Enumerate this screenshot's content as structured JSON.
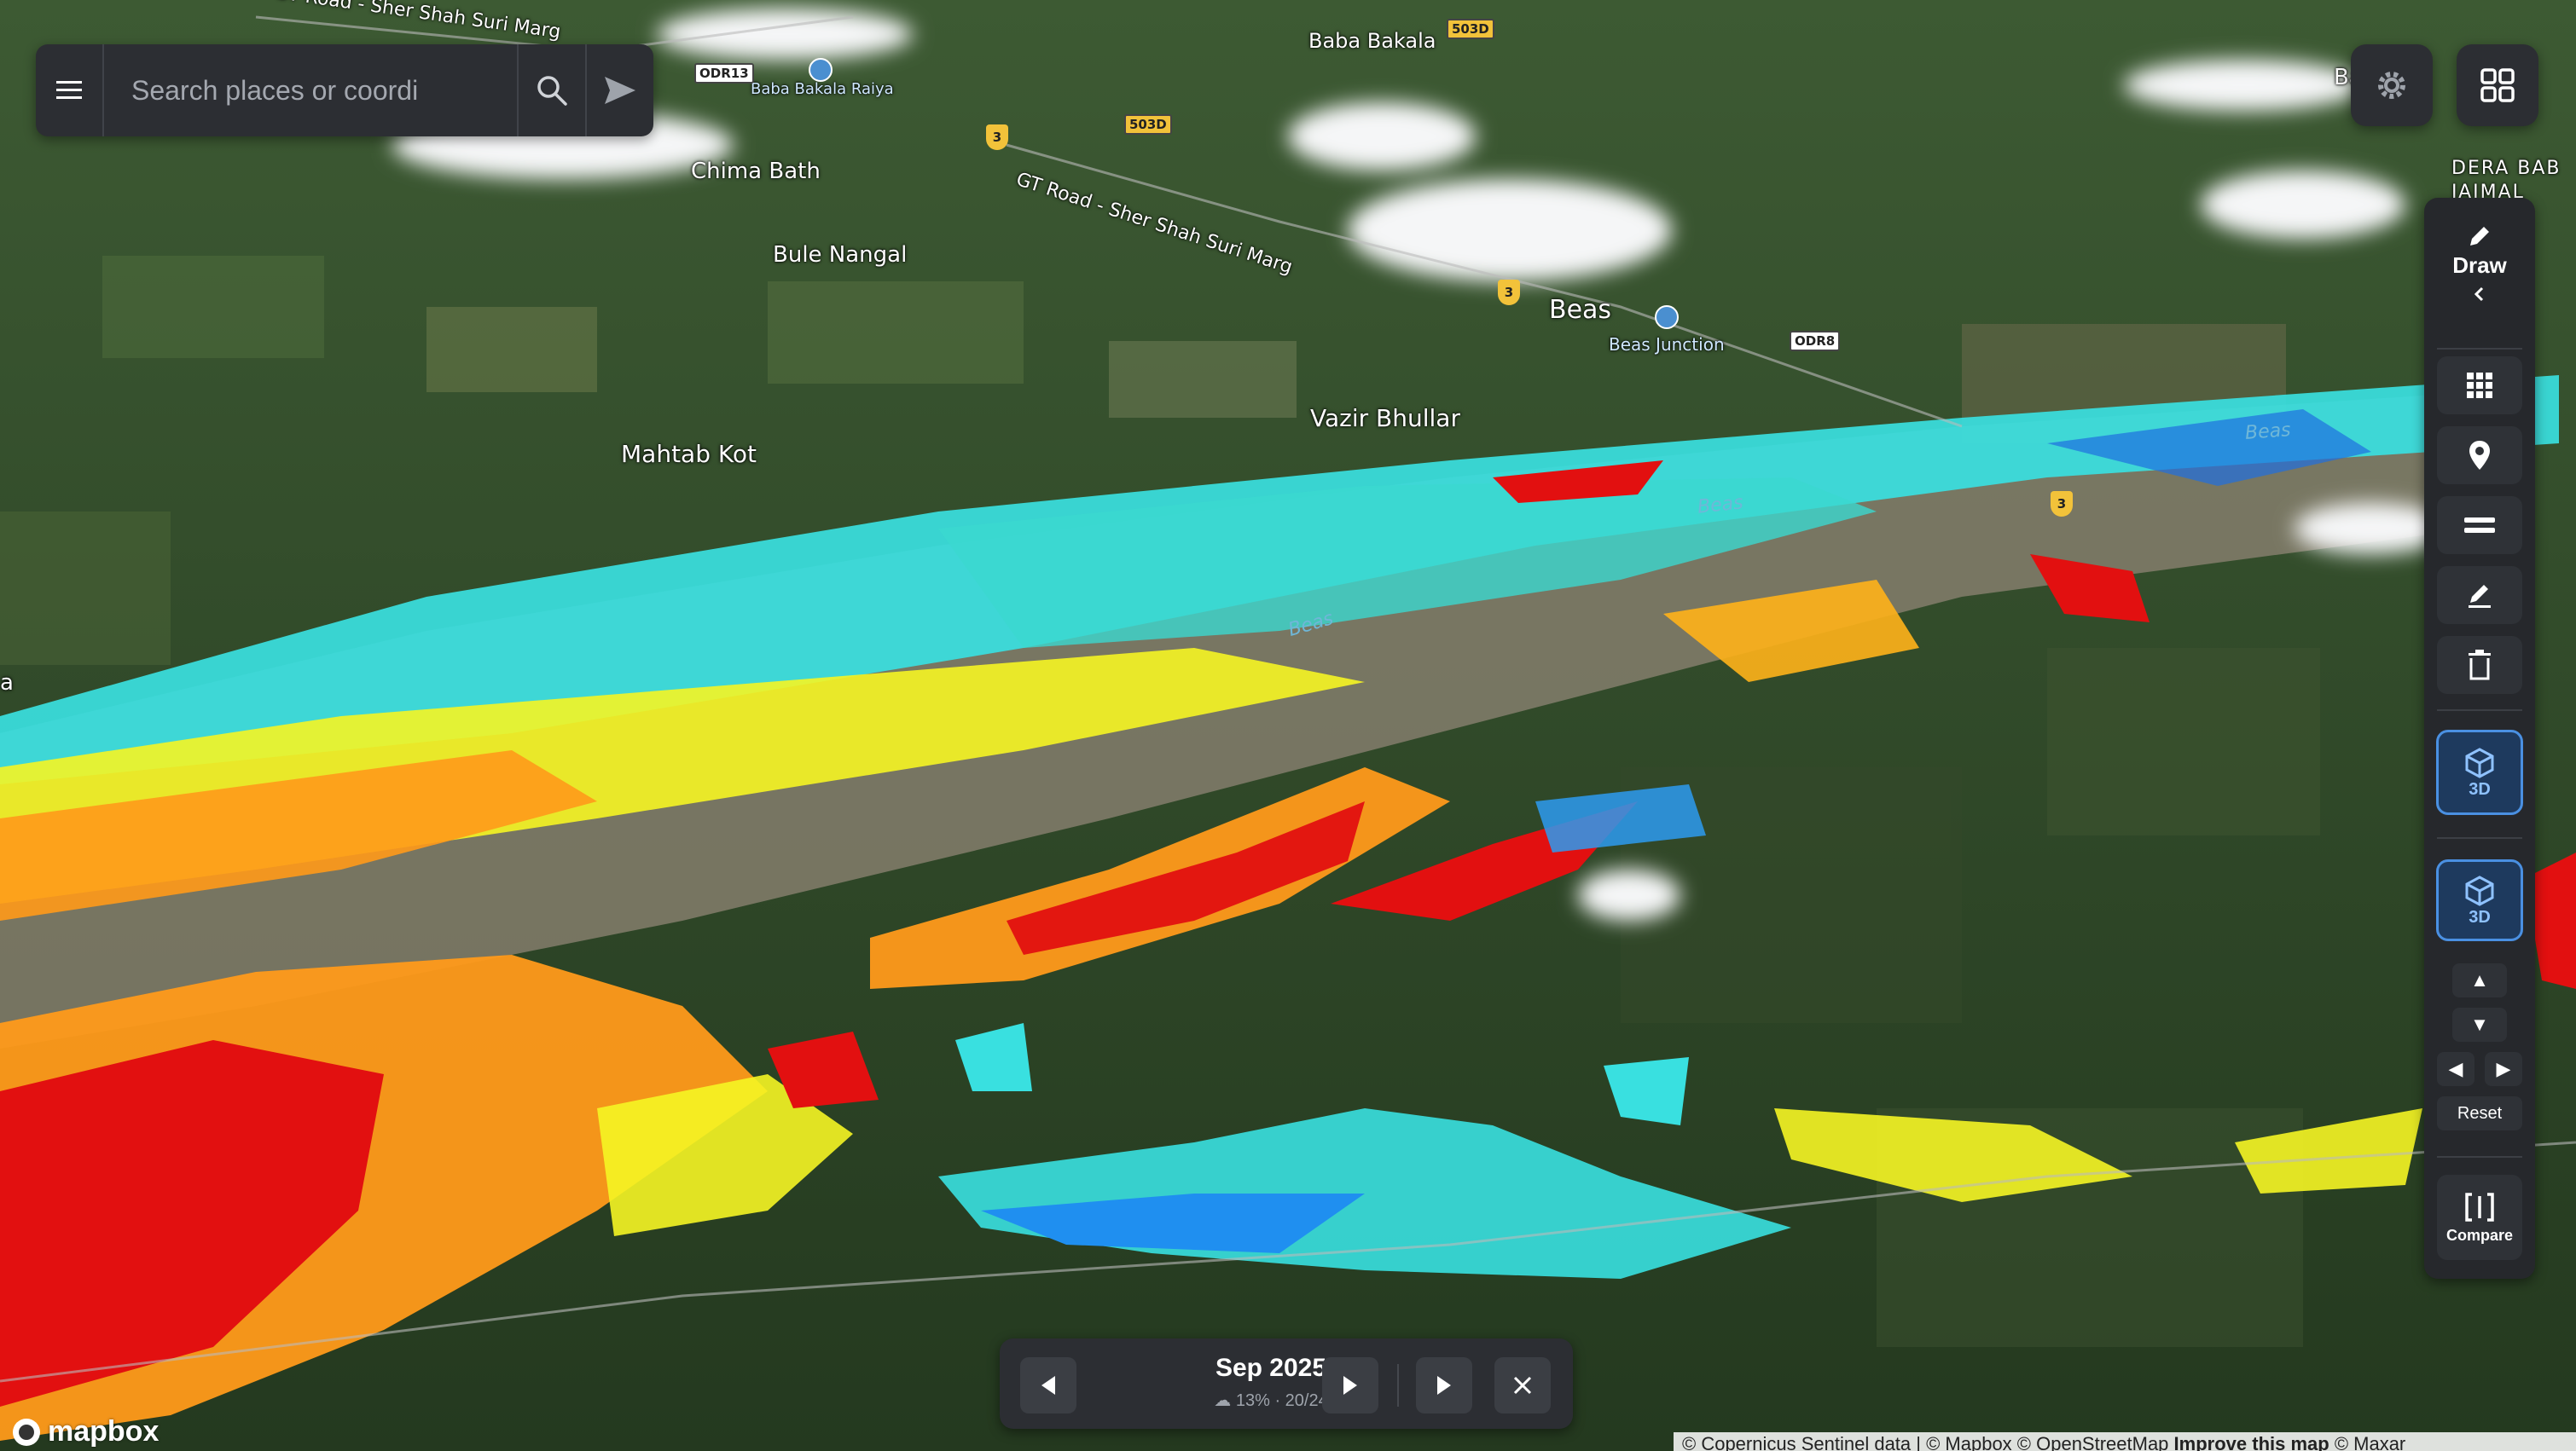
{
  "search": {
    "placeholder": "Search places or coordi"
  },
  "place_labels": {
    "gt_road_top": "GT Road - Sher Shah Suri Marg",
    "baba_bakala": "Baba Bakala",
    "baba_bakala_raiya": "Baba Bakala Raiya",
    "chima_bath": "Chima Bath",
    "gt_road": "GT Road - Sher Shah Suri Marg",
    "bule_nangal": "Bule Nangal",
    "beas": "Beas",
    "beas_junction": "Beas Junction",
    "vazir_bhullar": "Vazir Bhullar",
    "mahtab_kot": "Mahtab Kot",
    "dera_baba": "DERA BAB\nJAIMAL\nSINGH",
    "ba_cut": "Ba",
    "a_left": "a"
  },
  "river_labels": {
    "beas_1": "Beas",
    "beas_2": "Beas",
    "beas_3": "Beas"
  },
  "shields": {
    "odr13": "ODR13",
    "d503_a": "503D",
    "d503_b": "503D",
    "odr8": "ODR8",
    "nh3": "3"
  },
  "toolbar": {
    "draw_label": "Draw",
    "three_d_1": "3D",
    "three_d_2": "3D",
    "reset_label": "Reset",
    "compare_label": "Compare"
  },
  "timeline": {
    "date": "Sep 2025",
    "cloud": "13%",
    "position": "20/24"
  },
  "attribution": {
    "text": "© Copernicus Sentinel data | © Mapbox © OpenStreetMap ",
    "improve": "Improve this map",
    "maxar": " © Maxar"
  },
  "logo": {
    "text": "mapbox"
  },
  "colors": {
    "flood_low": "#1f6fe0",
    "flood_mid_low": "#39e0e0",
    "flood_mid": "#f5f523",
    "flood_mid_high": "#ff9a1a",
    "flood_high": "#e21010",
    "accent": "#4a90e2"
  },
  "icons": [
    "menu-icon",
    "search-icon",
    "send-icon",
    "settings-icon",
    "grid-icon",
    "pencil-icon",
    "chevron-left-icon",
    "dots-grid-icon",
    "location-pin-icon",
    "equals-icon",
    "edit-icon",
    "trash-icon",
    "cube-icon",
    "arrow-up-icon",
    "arrow-down-icon",
    "arrow-left-icon",
    "arrow-right-icon",
    "compare-icon",
    "play-prev-icon",
    "play-next-icon",
    "play-icon",
    "close-icon",
    "cloud-icon"
  ]
}
